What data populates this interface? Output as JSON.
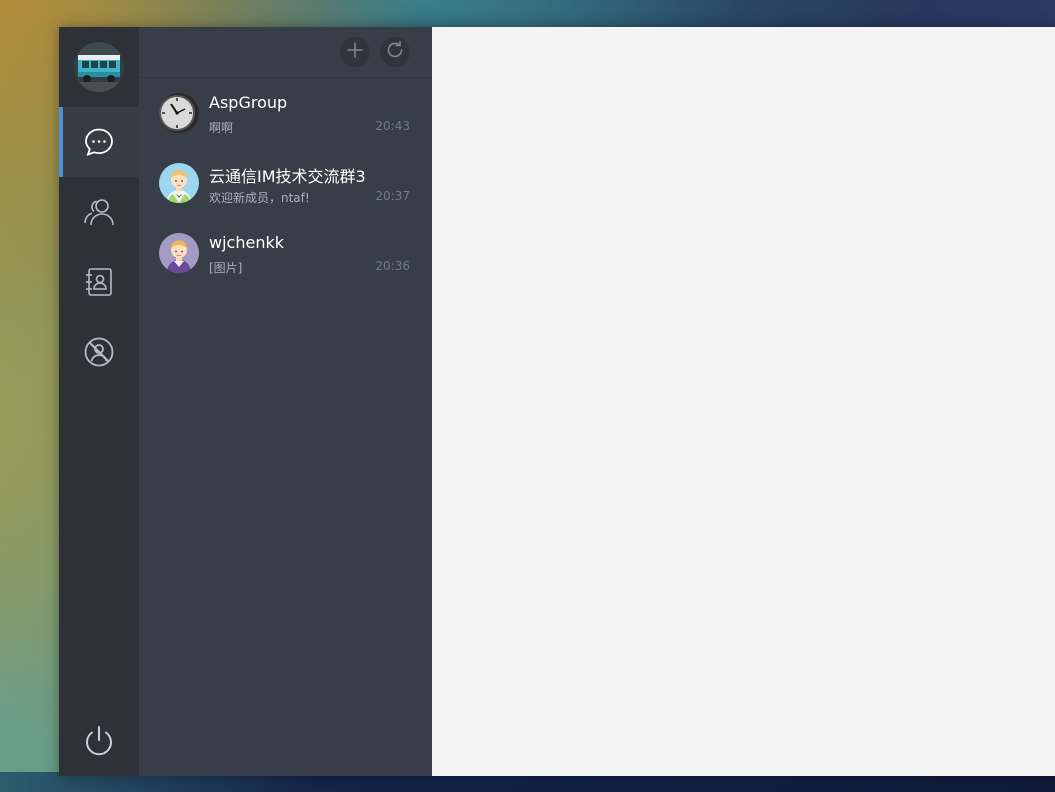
{
  "sidebar": {
    "nav": [
      {
        "key": "chat",
        "icon": "chat-bubble-icon",
        "active": true
      },
      {
        "key": "contacts",
        "icon": "contacts-icon",
        "active": false
      },
      {
        "key": "addressbook",
        "icon": "address-book-icon",
        "active": false
      },
      {
        "key": "blacklist",
        "icon": "blocked-user-icon",
        "active": false
      }
    ],
    "logout_icon": "power-icon",
    "accent": "#4a90d9"
  },
  "sessions": {
    "header_buttons": [
      {
        "icon": "plus-icon"
      },
      {
        "icon": "refresh-icon"
      }
    ],
    "items": [
      {
        "name": "AspGroup",
        "last": "啊啊",
        "time": "20:43",
        "avatar": "clock-avatar"
      },
      {
        "name": "云通信IM技术交流群3",
        "last": "欢迎新成员，ntaf!",
        "time": "20:37",
        "avatar": "boy-avatar"
      },
      {
        "name": "wjchenkk",
        "last": "[图片]",
        "time": "20:36",
        "avatar": "girl-avatar"
      }
    ]
  }
}
